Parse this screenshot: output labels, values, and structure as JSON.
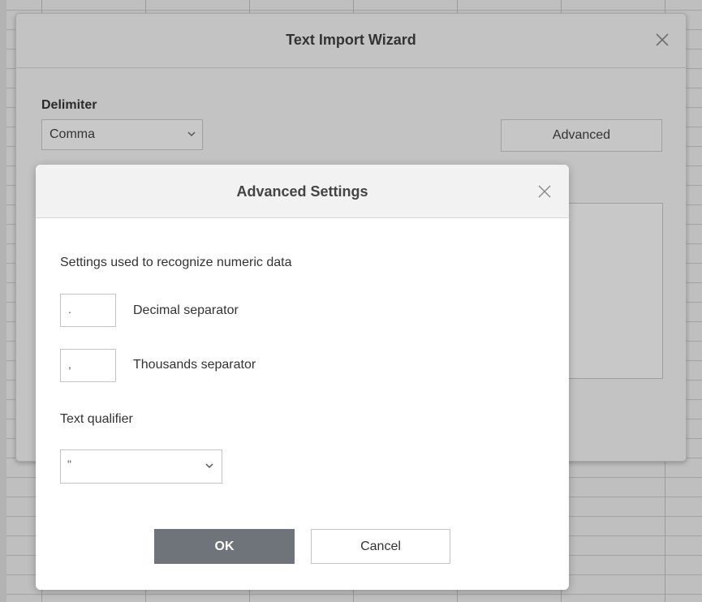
{
  "wizard": {
    "title": "Text Import Wizard",
    "delimiter_label": "Delimiter",
    "delimiter_value": "Comma",
    "advanced_label": "Advanced"
  },
  "advanced": {
    "title": "Advanced Settings",
    "numeric_heading": "Settings used to recognize numeric data",
    "decimal_value": ".",
    "decimal_label": "Decimal separator",
    "thousands_value": ",",
    "thousands_label": "Thousands separator",
    "qualifier_label": "Text qualifier",
    "qualifier_value": "\"",
    "ok_label": "OK",
    "cancel_label": "Cancel"
  },
  "icons": {
    "close": "close-icon",
    "dropdown": "chevron-down-icon"
  },
  "colors": {
    "ok_button": "#6f747a",
    "overlay": "#bdbdbd",
    "modal_header": "#f2f2f2"
  }
}
